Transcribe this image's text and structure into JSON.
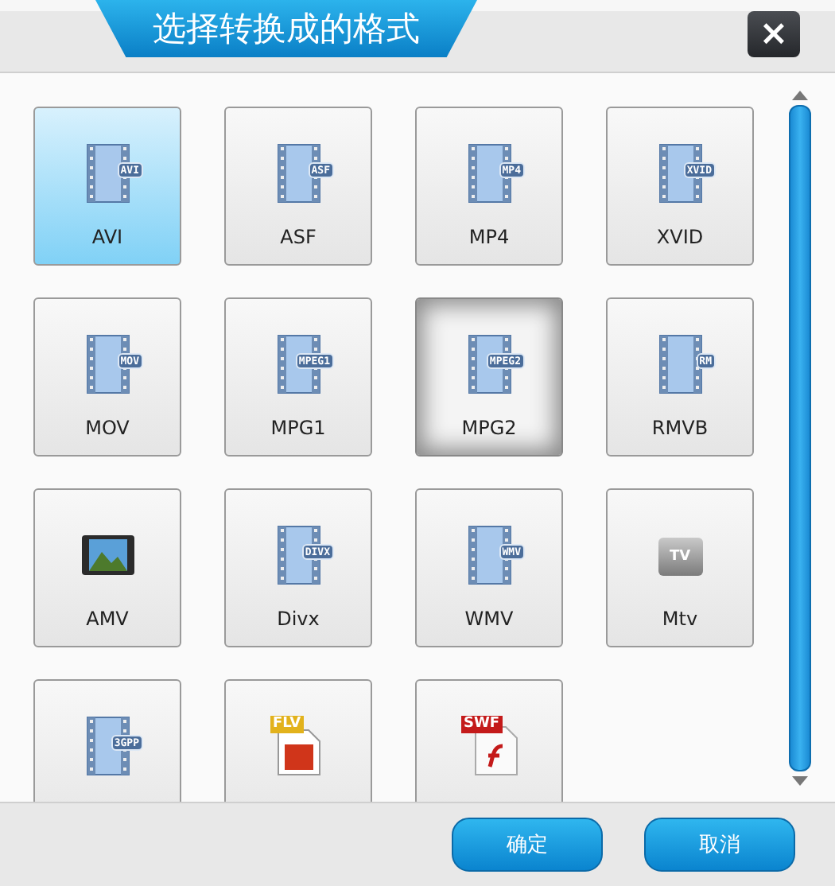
{
  "dialog": {
    "title": "选择转换成的格式",
    "close_label": "×"
  },
  "formats": [
    {
      "kind": "film",
      "badge": "AVI",
      "label": "AVI",
      "selected": true,
      "focused": false
    },
    {
      "kind": "film",
      "badge": "ASF",
      "label": "ASF",
      "selected": false,
      "focused": false
    },
    {
      "kind": "film",
      "badge": "MP4",
      "label": "MP4",
      "selected": false,
      "focused": false
    },
    {
      "kind": "film",
      "badge": "XVID",
      "label": "XVID",
      "selected": false,
      "focused": false
    },
    {
      "kind": "film",
      "badge": "MOV",
      "label": "MOV",
      "selected": false,
      "focused": false
    },
    {
      "kind": "film",
      "badge": "MPEG1",
      "label": "MPG1",
      "selected": false,
      "focused": false
    },
    {
      "kind": "film",
      "badge": "MPEG2",
      "label": "MPG2",
      "selected": false,
      "focused": true
    },
    {
      "kind": "film",
      "badge": "RM",
      "label": "RMVB",
      "selected": false,
      "focused": false
    },
    {
      "kind": "photo",
      "label": "AMV",
      "selected": false,
      "focused": false
    },
    {
      "kind": "film",
      "badge": "DIVX",
      "label": "Divx",
      "selected": false,
      "focused": false
    },
    {
      "kind": "film",
      "badge": "WMV",
      "label": "WMV",
      "selected": false,
      "focused": false
    },
    {
      "kind": "tv",
      "badge": "TV",
      "label": "Mtv",
      "selected": false,
      "focused": false
    },
    {
      "kind": "film",
      "badge": "3GPP",
      "selected": false,
      "focused": false
    },
    {
      "kind": "flv",
      "badge": "FLV",
      "selected": false,
      "focused": false
    },
    {
      "kind": "swf",
      "badge": "SWF",
      "selected": false,
      "focused": false
    }
  ],
  "buttons": [
    {
      "label": "确定"
    },
    {
      "label": "取消"
    }
  ]
}
